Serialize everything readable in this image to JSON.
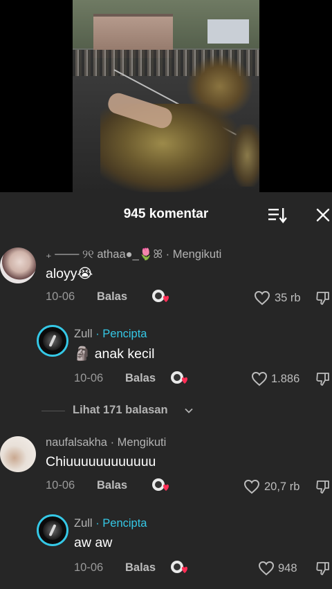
{
  "header": {
    "comment_count_label": "945 komentar"
  },
  "icons": {
    "sort": "sort-icon",
    "close": "close-icon",
    "like": "heart-icon",
    "dislike": "thumbs-down-icon",
    "reaction": "heart-sticker-icon"
  },
  "colors": {
    "creator_accent": "#35c8e6",
    "panel_bg": "#262626"
  },
  "comments": [
    {
      "username": "₊ ─── ୨୧ athaa●_🌷ꕤ",
      "status": "· Mengikuti",
      "text": "aloyy😭",
      "date": "10-06",
      "reply_label": "Balas",
      "likes": "35 rb",
      "reply": {
        "username": "Zull",
        "tag": "· Pencipta",
        "text": "🗿 anak kecil",
        "date": "10-06",
        "reply_label": "Balas",
        "likes": "1.886"
      }
    },
    {
      "username": "naufalsakha",
      "status": "· Mengikuti",
      "text": "Chiuuuuuuuuuuuu",
      "date": "10-06",
      "reply_label": "Balas",
      "likes": "20,7 rb",
      "reply": {
        "username": "Zull",
        "tag": "· Pencipta",
        "text": "aw aw",
        "date": "10-06",
        "reply_label": "Balas",
        "likes": "948"
      }
    }
  ],
  "view_replies_label": "Lihat 171 balasan"
}
